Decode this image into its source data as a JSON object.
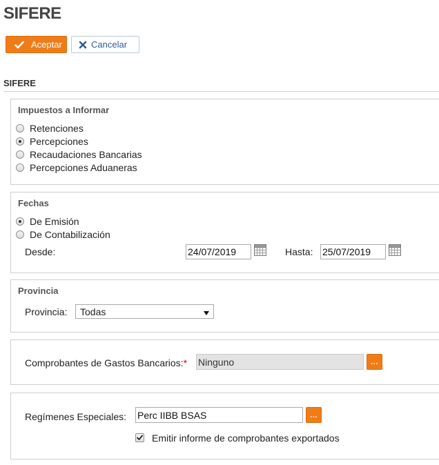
{
  "page": {
    "title": "SIFERE"
  },
  "toolbar": {
    "accept_label": "Aceptar",
    "cancel_label": "Cancelar"
  },
  "section": {
    "heading": "SIFERE"
  },
  "impuestos": {
    "legend": "Impuestos a Informar",
    "options": [
      {
        "label": "Retenciones",
        "checked": false
      },
      {
        "label": "Percepciones",
        "checked": true
      },
      {
        "label": "Recaudaciones Bancarias",
        "checked": false
      },
      {
        "label": "Percepciones Aduaneras",
        "checked": false
      }
    ]
  },
  "fechas": {
    "legend": "Fechas",
    "options": [
      {
        "label": "De Emisión",
        "checked": true
      },
      {
        "label": "De Contabilización",
        "checked": false
      }
    ],
    "desde_label": "Desde:",
    "desde_value": "24/07/2019",
    "hasta_label": "Hasta:",
    "hasta_value": "25/07/2019"
  },
  "provincia": {
    "legend": "Provincia",
    "label": "Provincia:",
    "selected": "Todas"
  },
  "gastos": {
    "label": "Comprobantes de Gastos Bancarios:",
    "required_mark": "*",
    "value": "Ninguno",
    "lookup_label": "..."
  },
  "regimenes": {
    "label": "Regímenes Especiales:",
    "value": "Perc IIBB BSAS",
    "lookup_label": "...",
    "checkbox_label": "Emitir informe de comprobantes exportados",
    "checkbox_checked": true
  },
  "icons": {
    "accept": "check-icon",
    "cancel": "close-icon",
    "calendar": "calendar-icon",
    "dropdown": "caret-down-icon"
  },
  "colors": {
    "accent": "#f07c17",
    "link": "#2a5d9a"
  }
}
